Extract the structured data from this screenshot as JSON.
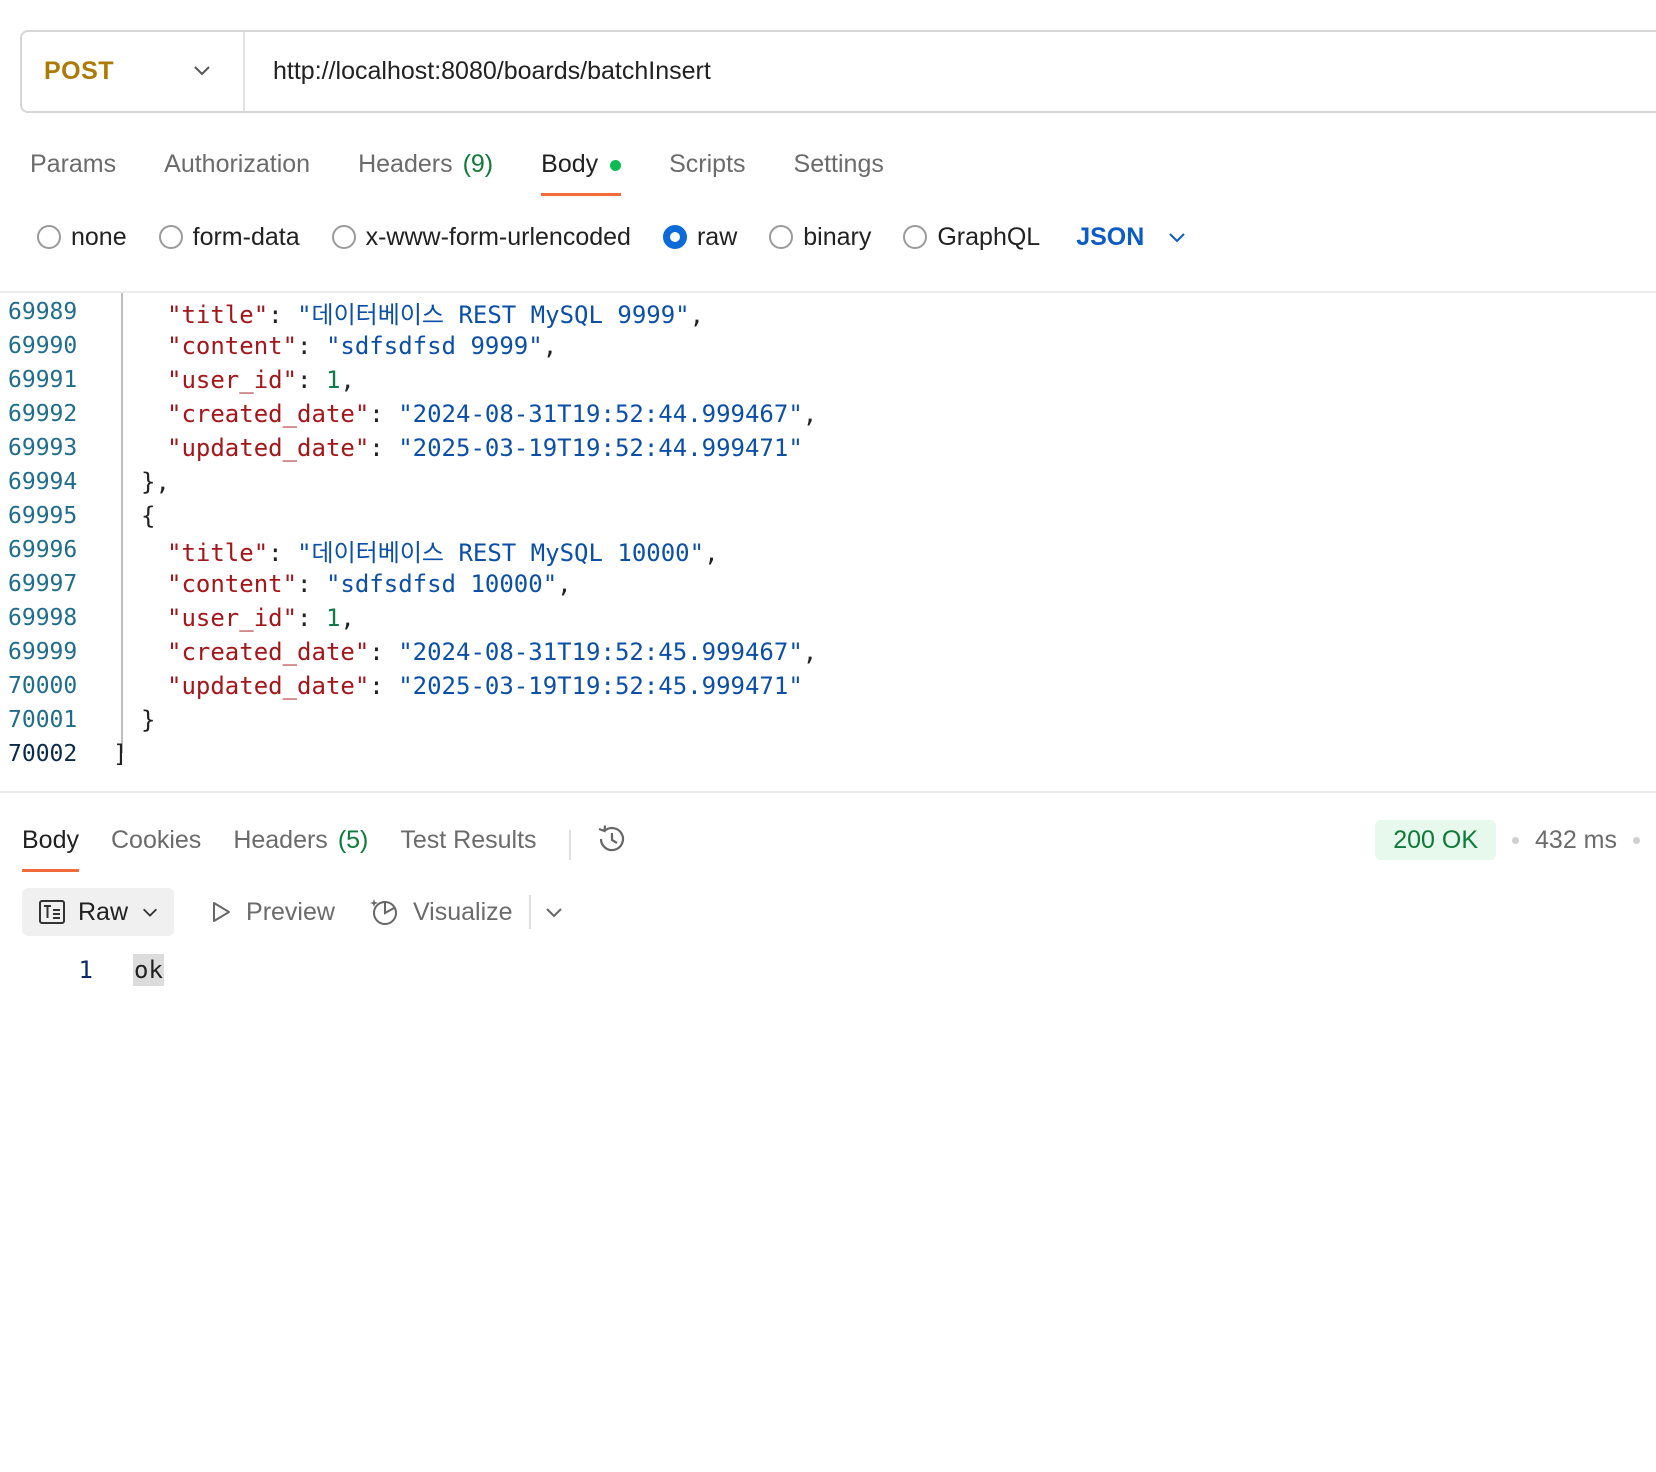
{
  "request": {
    "method": "POST",
    "url": "http://localhost:8080/boards/batchInsert"
  },
  "request_tabs": [
    {
      "label": "Params"
    },
    {
      "label": "Authorization"
    },
    {
      "label": "Headers",
      "count": "(9)"
    },
    {
      "label": "Body",
      "active": true,
      "modified": true
    },
    {
      "label": "Scripts"
    },
    {
      "label": "Settings"
    }
  ],
  "body_options": {
    "none": "none",
    "form_data": "form-data",
    "urlencoded": "x-www-form-urlencoded",
    "raw": "raw",
    "binary": "binary",
    "graphql": "GraphQL",
    "selected": "raw",
    "format": "JSON"
  },
  "editor": {
    "lines": [
      {
        "n": "69989",
        "key": "\"title\"",
        "val": "\"데이터베이스 REST MySQL 9999\"",
        "tail": ","
      },
      {
        "n": "69990",
        "key": "\"content\"",
        "val": "\"sdfsdfsd 9999\"",
        "tail": ","
      },
      {
        "n": "69991",
        "key": "\"user_id\"",
        "num": "1",
        "tail": ","
      },
      {
        "n": "69992",
        "key": "\"created_date\"",
        "val": "\"2024-08-31T19:52:44.999467\"",
        "tail": ","
      },
      {
        "n": "69993",
        "key": "\"updated_date\"",
        "val": "\"2025-03-19T19:52:44.999471\"",
        "tail": ""
      },
      {
        "n": "69994",
        "punct": "},"
      },
      {
        "n": "69995",
        "punct": "{"
      },
      {
        "n": "69996",
        "key": "\"title\"",
        "val": "\"데이터베이스 REST MySQL 10000\"",
        "tail": ","
      },
      {
        "n": "69997",
        "key": "\"content\"",
        "val": "\"sdfsdfsd 10000\"",
        "tail": ","
      },
      {
        "n": "69998",
        "key": "\"user_id\"",
        "num": "1",
        "tail": ","
      },
      {
        "n": "69999",
        "key": "\"created_date\"",
        "val": "\"2024-08-31T19:52:45.999467\"",
        "tail": ","
      },
      {
        "n": "70000",
        "key": "\"updated_date\"",
        "val": "\"2025-03-19T19:52:45.999471\"",
        "tail": ""
      },
      {
        "n": "70001",
        "punct": "}"
      },
      {
        "n": "70002",
        "punct": "]"
      }
    ]
  },
  "response_tabs": [
    {
      "label": "Body",
      "active": true
    },
    {
      "label": "Cookies"
    },
    {
      "label": "Headers",
      "count": "(5)"
    },
    {
      "label": "Test Results"
    }
  ],
  "response_status": {
    "status": "200 OK",
    "time": "432 ms",
    "status_color": "#0d7a36"
  },
  "response_toolbar": {
    "raw_label": "Raw",
    "preview_label": "Preview",
    "visualize_label": "Visualize"
  },
  "response_body": {
    "line_number": "1",
    "text": "ok"
  },
  "colors": {
    "method": "#ad7a03",
    "accent_tab": "#f26b3a",
    "json_key": "#a4161a",
    "json_string": "#0b4fa8",
    "json_number": "#0f7b4a",
    "radio_selected": "#0c6bd8"
  }
}
